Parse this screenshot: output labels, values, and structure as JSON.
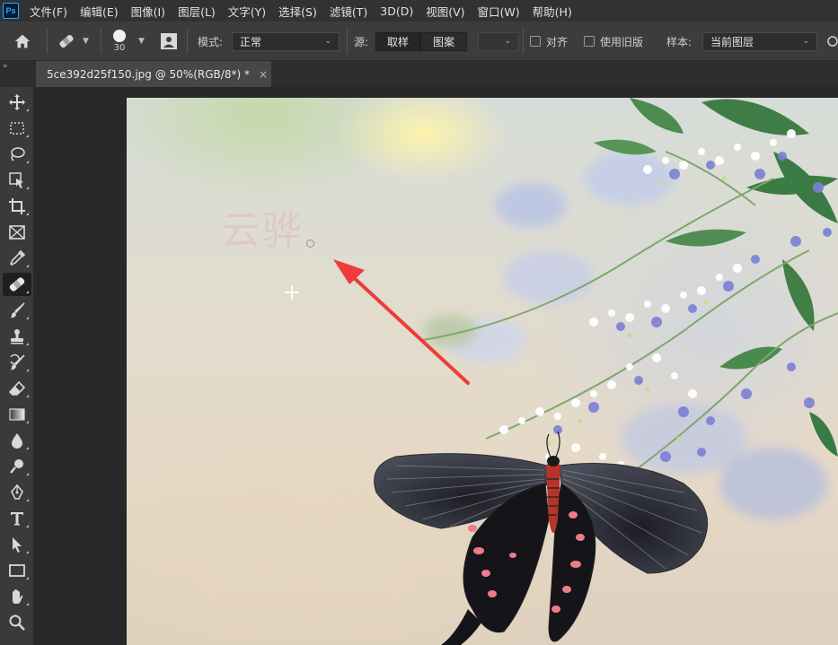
{
  "app": {
    "logo_text": "Ps"
  },
  "menu": [
    "文件(F)",
    "编辑(E)",
    "图像(I)",
    "图层(L)",
    "文字(Y)",
    "选择(S)",
    "滤镜(T)",
    "3D(D)",
    "视图(V)",
    "窗口(W)",
    "帮助(H)"
  ],
  "options": {
    "brush_size": "30",
    "mode_label": "模式:",
    "mode_value": "正常",
    "source_label": "源:",
    "source_sampled": "取样",
    "source_pattern": "图案",
    "aligned_label": "对齐",
    "legacy_label": "使用旧版",
    "sample_label": "样本:",
    "sample_value": "当前图层"
  },
  "document": {
    "tab_title": "5ce392d25f150.jpg @ 50%(RGB/8*) *",
    "close_glyph": "×",
    "collapse_glyph": "»"
  },
  "canvas": {
    "watermark_text": "云骅"
  },
  "colors": {
    "accent": "#31a8ff",
    "annotation_arrow": "#ee3b3b"
  },
  "tools": [
    "move-tool-icon",
    "marquee-tool-icon",
    "lasso-tool-icon",
    "object-select-tool-icon",
    "crop-tool-icon",
    "frame-tool-icon",
    "eyedropper-tool-icon",
    "healing-brush-tool-icon",
    "brush-tool-icon",
    "clone-stamp-tool-icon",
    "history-brush-tool-icon",
    "eraser-tool-icon",
    "gradient-tool-icon",
    "blur-tool-icon",
    "dodge-tool-icon",
    "pen-tool-icon",
    "type-tool-icon",
    "path-select-tool-icon",
    "rectangle-tool-icon",
    "hand-tool-icon",
    "zoom-tool-icon"
  ]
}
